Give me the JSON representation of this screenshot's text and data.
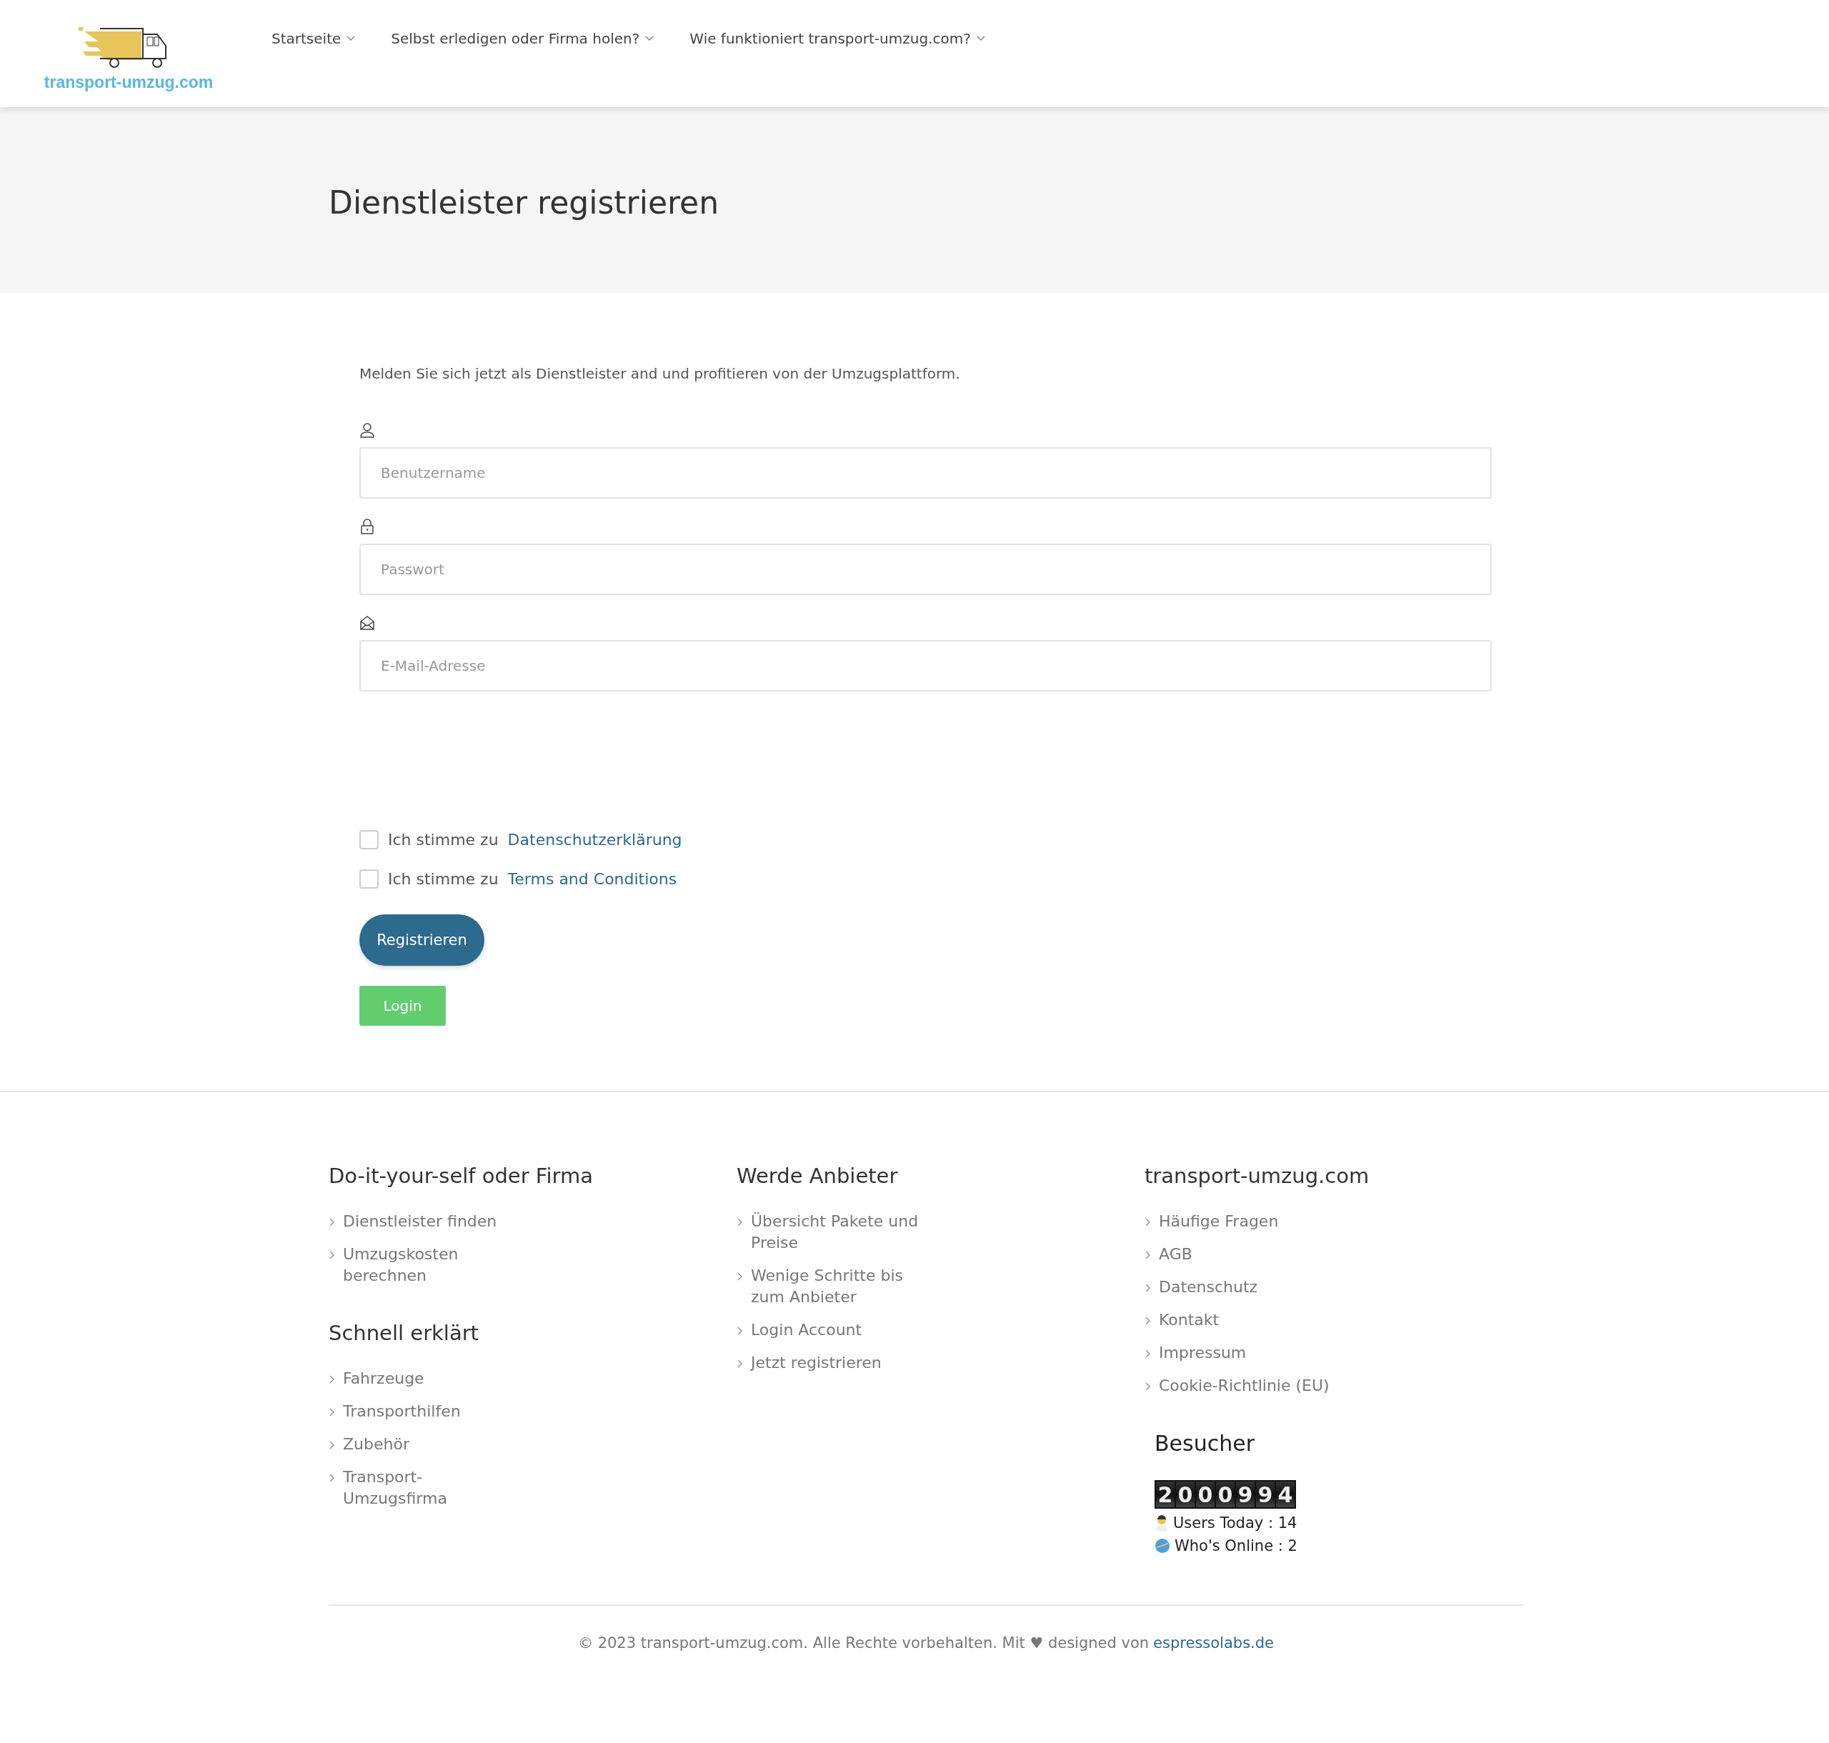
{
  "header": {
    "logo_text": "transport-umzug.com",
    "nav": [
      {
        "label": "Startseite",
        "has_dropdown": true
      },
      {
        "label": "Selbst erledigen oder Firma holen?",
        "has_dropdown": true
      },
      {
        "label": "Wie funktioniert transport-umzug.com?",
        "has_dropdown": true
      }
    ]
  },
  "page_title": "Dienstleister registrieren",
  "form": {
    "intro": "Melden Sie sich jetzt als Dienstleister and und profitieren von der Umzugsplattform.",
    "fields": [
      {
        "kind": "user",
        "placeholder": "Benutzername"
      },
      {
        "kind": "lock",
        "placeholder": "Passwort"
      },
      {
        "kind": "mail",
        "placeholder": "E-Mail-Adresse"
      }
    ],
    "consents": [
      {
        "text": "Ich stimme zu",
        "link": "Datenschutzerklärung",
        "checked": false
      },
      {
        "text": "Ich stimme zu",
        "link": "Terms and Conditions",
        "checked": false
      }
    ],
    "register_button": "Registrieren",
    "login_button": "Login"
  },
  "footer": {
    "columns": [
      {
        "sections": [
          {
            "title": "Do-it-your-self oder Firma",
            "links": [
              "Dienstleister finden",
              "Umzugskosten berechnen"
            ]
          },
          {
            "title": "Schnell erklärt",
            "links": [
              "Fahrzeuge",
              "Transporthilfen",
              "Zubehör",
              "Transport-Umzugsfirma"
            ]
          }
        ]
      },
      {
        "sections": [
          {
            "title": "Werde Anbieter",
            "links": [
              "Übersicht Pakete und Preise",
              "Wenige Schritte bis zum Anbieter",
              "Login Account",
              "Jetzt registrieren"
            ]
          }
        ]
      },
      {
        "sections": [
          {
            "title": "transport-umzug.com",
            "links": [
              "Häufige Fragen",
              "AGB",
              "Datenschutz",
              "Kontakt",
              "Impressum",
              "Cookie-Richtlinie (EU)"
            ]
          }
        ],
        "visitors": {
          "title": "Besucher",
          "counter": "2000994",
          "stats": [
            {
              "kind": "users",
              "text": "Users Today : 14"
            },
            {
              "kind": "online",
              "text": "Who's Online : 2"
            }
          ]
        }
      }
    ],
    "copyright": "© 2023 transport-umzug.com. Alle Rechte vorbehalten. Mit ♥ designed von",
    "copyright_link": "espressolabs.de"
  }
}
